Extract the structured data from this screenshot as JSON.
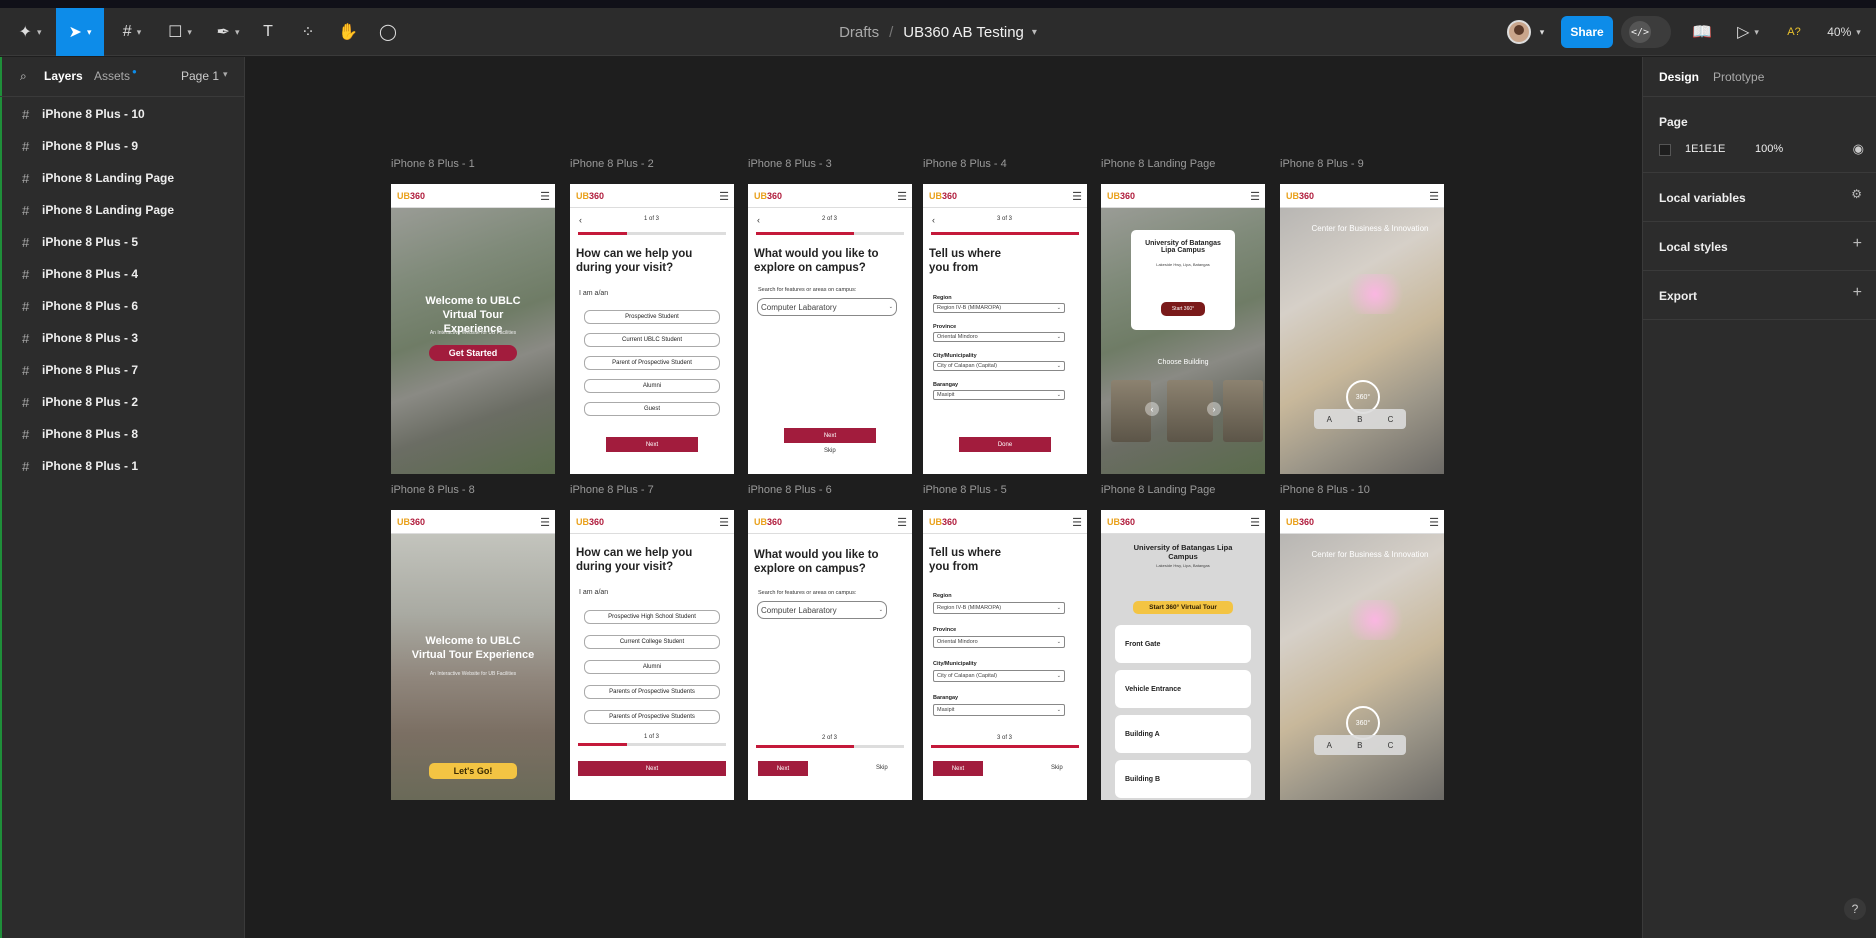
{
  "breadcrumb": {
    "drafts": "Drafts",
    "file": "UB360 AB Testing"
  },
  "toolbar": {
    "share": "Share",
    "dev_mode": "</>",
    "ai": "A?",
    "zoom": "40%"
  },
  "left_panel": {
    "layers_tab": "Layers",
    "assets_tab": "Assets",
    "page": "Page 1",
    "layers": [
      "iPhone 8 Plus - 10",
      "iPhone 8 Plus - 9",
      "iPhone 8 Landing Page",
      "iPhone 8 Landing Page",
      "iPhone 8 Plus - 5",
      "iPhone 8 Plus - 4",
      "iPhone 8 Plus - 6",
      "iPhone 8 Plus - 3",
      "iPhone 8 Plus - 7",
      "iPhone 8 Plus - 2",
      "iPhone 8 Plus - 8",
      "iPhone 8 Plus - 1"
    ]
  },
  "right_panel": {
    "design_tab": "Design",
    "prototype_tab": "Prototype",
    "page_title": "Page",
    "page_color": "1E1E1E",
    "page_opacity": "100%",
    "local_variables": "Local variables",
    "local_styles": "Local styles",
    "export": "Export"
  },
  "frames": {
    "labels": [
      "iPhone 8 Plus - 1",
      "iPhone 8 Plus - 2",
      "iPhone 8 Plus - 3",
      "iPhone 8 Plus - 4",
      "iPhone 8 Landing Page",
      "iPhone 8 Plus - 9",
      "iPhone 8 Plus - 8",
      "iPhone 8 Plus - 7",
      "iPhone 8 Plus - 6",
      "iPhone 8 Plus - 5",
      "iPhone 8 Landing Page",
      "iPhone 8 Plus - 10"
    ],
    "logo_u": "UB",
    "logo_num": "360",
    "welcome": "Welcome to UBLC Virtual Tour Experience",
    "welcome_sub": "An Interactive Website for UB Facilities",
    "get_started": "Get Started",
    "lets_go": "Let's Go!",
    "q_help": "How can we help you during your visit?",
    "i_am": "I am a/an",
    "step1": "1 of 3",
    "step2": "2 of 3",
    "step3": "3 of 3",
    "opts_a": [
      "Prospective Student",
      "Current UBLC Student",
      "Parent of Prospective Student",
      "Alumni",
      "Guest"
    ],
    "opts_b": [
      "Prospective High School Student",
      "Current College Student",
      "Alumni",
      "Parents of Prospective Students",
      "Parents of Prospective Students"
    ],
    "next": "Next",
    "skip": "Skip",
    "done": "Done",
    "q_explore": "What would you like to explore on campus?",
    "search_label": "Search for features or areas on campus:",
    "search_value": "Computer Labaratory",
    "q_where": "Tell us where you from",
    "region_label": "Region",
    "region": "Region IV-B (MIMAROPA)",
    "province_label": "Province",
    "province": "Oriental Mindoro",
    "city_label": "City/Municipality",
    "city": "City of Calapan (Capital)",
    "barangay_label": "Barangay",
    "barangay": "Masipit",
    "uni": "University of Batangas Lipa Campus",
    "uni_addr": "Lakeside Hwy, Lipa, Batangas",
    "start360": "Start 360°",
    "start360_tour": "Start 360° Virtual Tour",
    "choose_building": "Choose Building",
    "cards": [
      "Front Gate",
      "Vehicle Entrance",
      "Building A",
      "Building B"
    ],
    "cbi": "Center for Business & Innovation",
    "vr": "360°",
    "tabs": [
      "A",
      "B",
      "C"
    ]
  }
}
